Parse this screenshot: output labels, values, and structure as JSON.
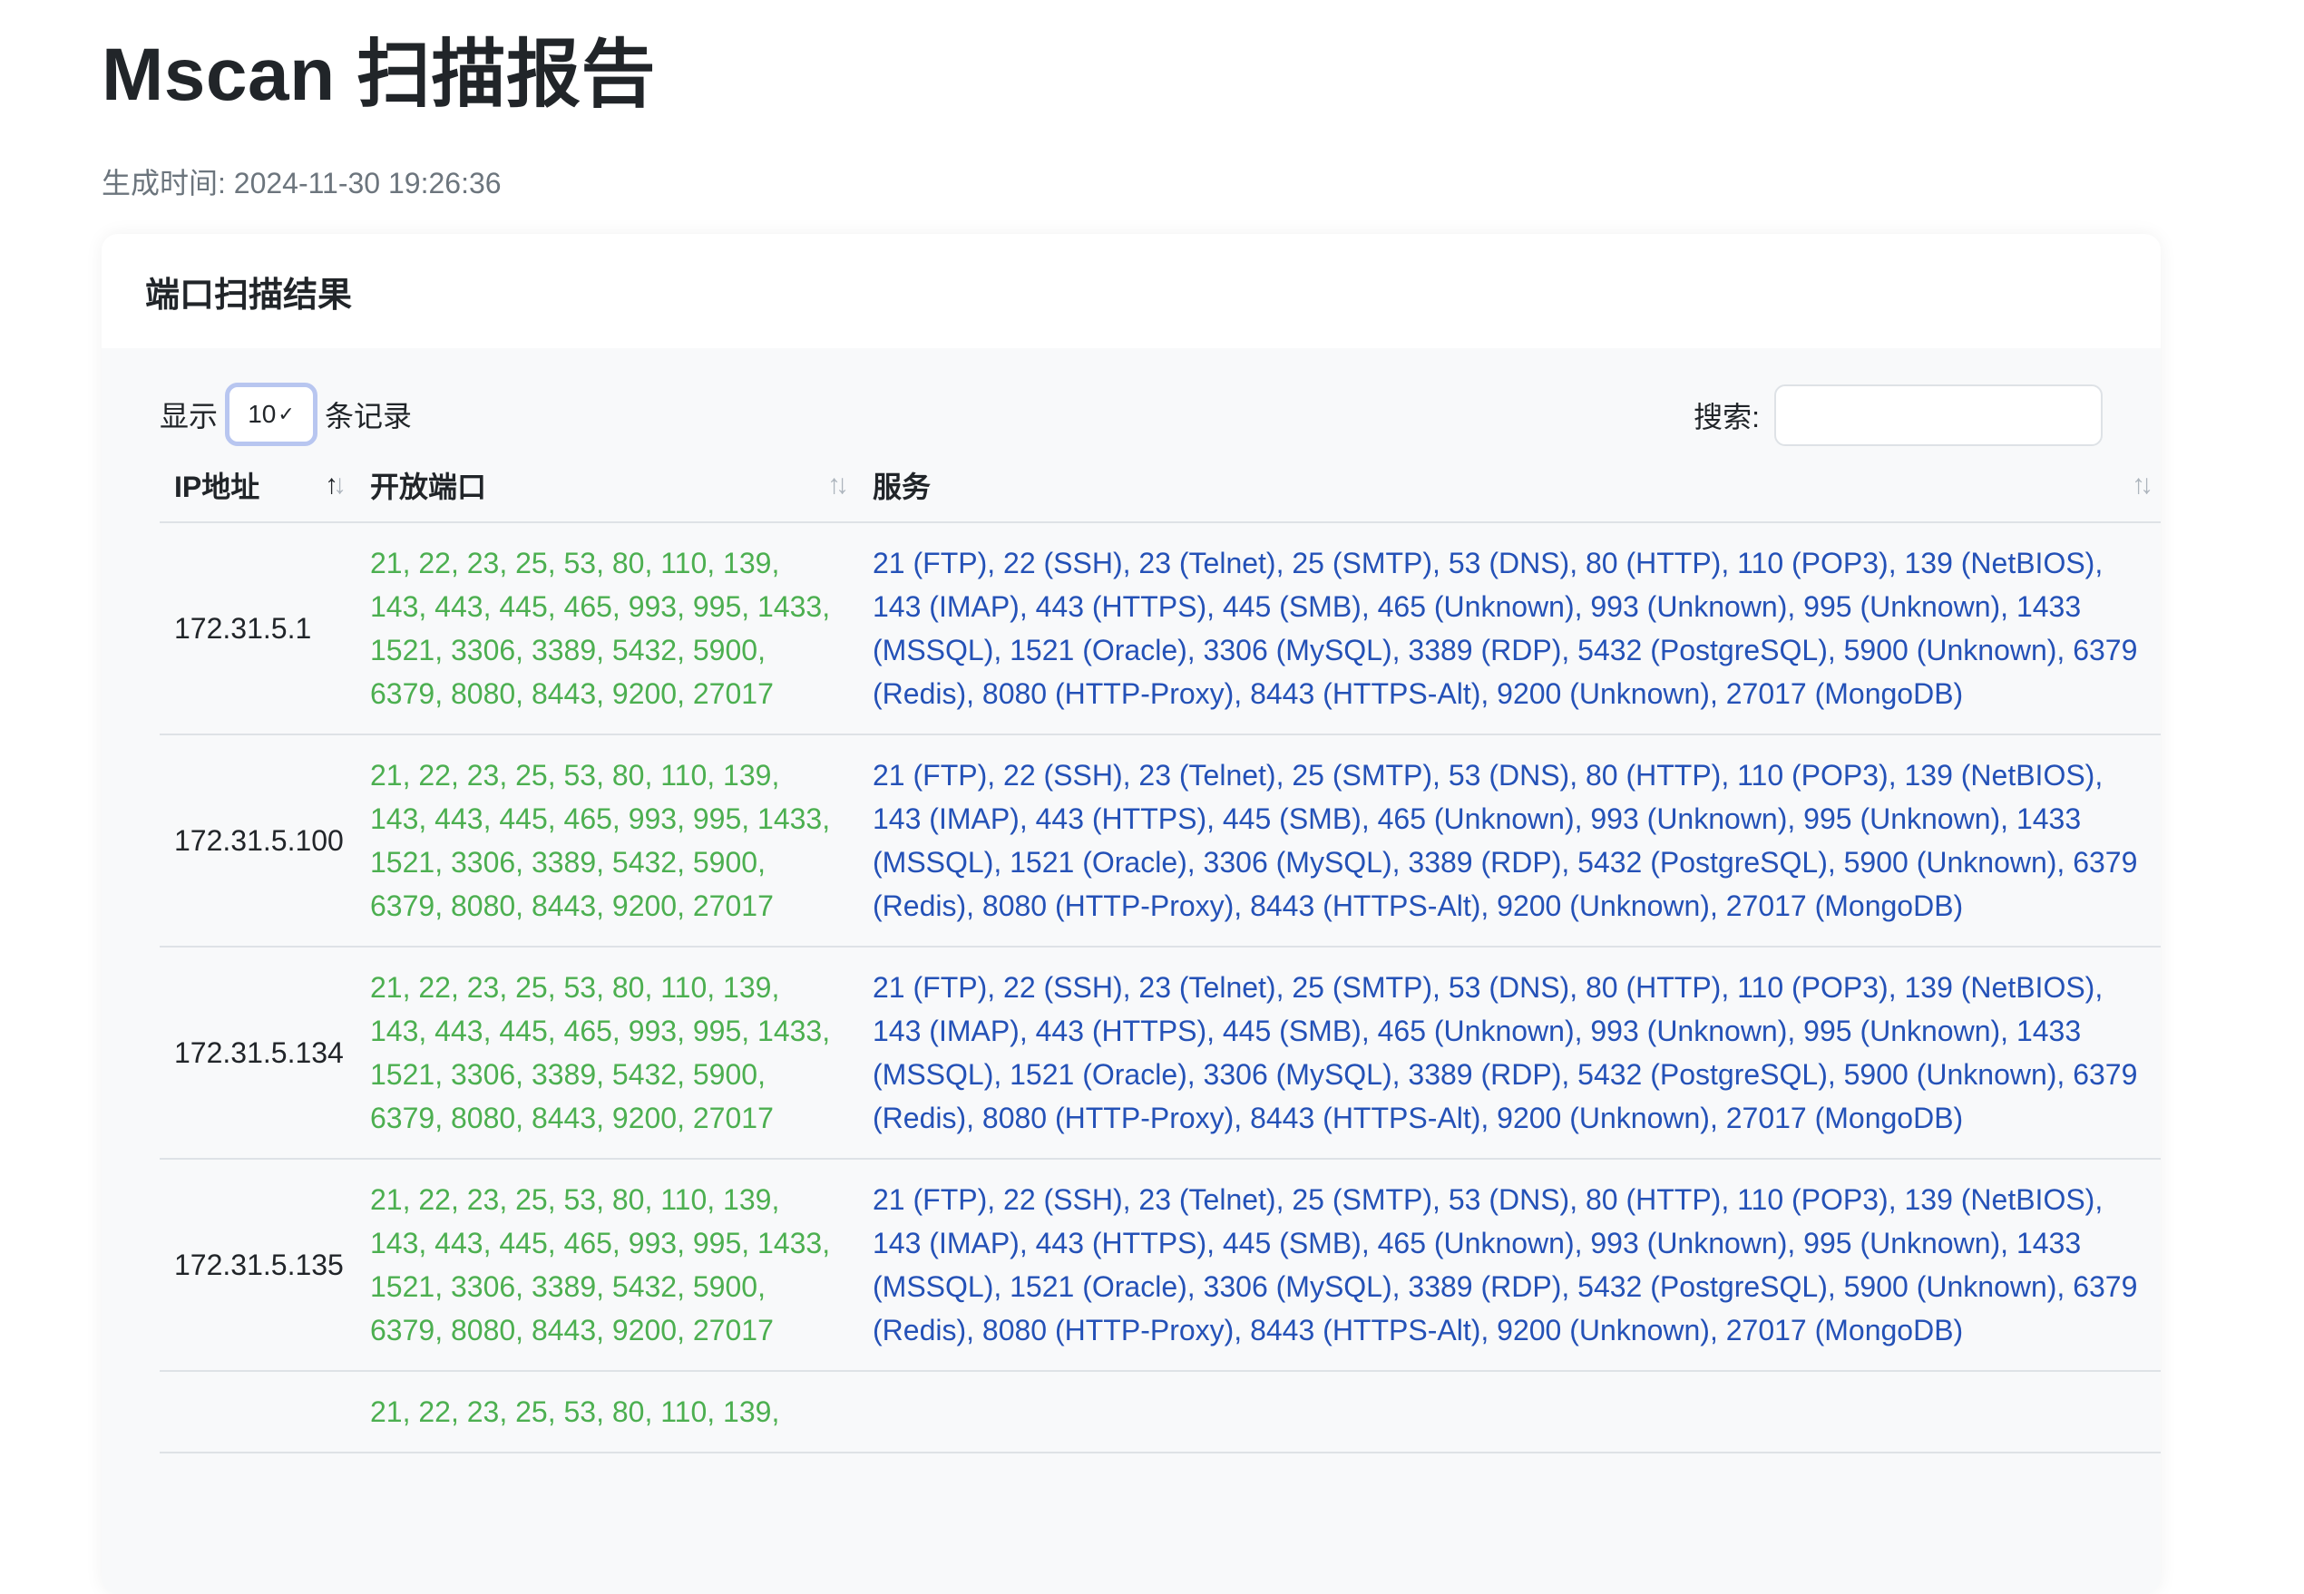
{
  "page": {
    "title": "Mscan 扫描报告",
    "generated": "生成时间: 2024-11-30 19:26:36"
  },
  "card": {
    "title": "端口扫描结果"
  },
  "controls": {
    "length_prefix": "显示",
    "length_value": "10",
    "length_suffix": "条记录",
    "search_label": "搜索:",
    "search_value": ""
  },
  "table": {
    "headers": [
      "IP地址",
      "开放端口",
      "服务"
    ],
    "rows": [
      {
        "ip": "172.31.5.1",
        "ports": "21, 22, 23, 25, 53, 80, 110, 139, 143, 443, 445, 465, 993, 995, 1433, 1521, 3306, 3389, 5432, 5900, 6379, 8080, 8443, 9200, 27017",
        "services": "21 (FTP), 22 (SSH), 23 (Telnet), 25 (SMTP), 53 (DNS), 80 (HTTP), 110 (POP3), 139 (NetBIOS), 143 (IMAP), 443 (HTTPS), 445 (SMB), 465 (Unknown), 993 (Unknown), 995 (Unknown), 1433 (MSSQL), 1521 (Oracle), 3306 (MySQL), 3389 (RDP), 5432 (PostgreSQL), 5900 (Unknown), 6379 (Redis), 8080 (HTTP-Proxy), 8443 (HTTPS-Alt), 9200 (Unknown), 27017 (MongoDB)"
      },
      {
        "ip": "172.31.5.100",
        "ports": "21, 22, 23, 25, 53, 80, 110, 139, 143, 443, 445, 465, 993, 995, 1433, 1521, 3306, 3389, 5432, 5900, 6379, 8080, 8443, 9200, 27017",
        "services": "21 (FTP), 22 (SSH), 23 (Telnet), 25 (SMTP), 53 (DNS), 80 (HTTP), 110 (POP3), 139 (NetBIOS), 143 (IMAP), 443 (HTTPS), 445 (SMB), 465 (Unknown), 993 (Unknown), 995 (Unknown), 1433 (MSSQL), 1521 (Oracle), 3306 (MySQL), 3389 (RDP), 5432 (PostgreSQL), 5900 (Unknown), 6379 (Redis), 8080 (HTTP-Proxy), 8443 (HTTPS-Alt), 9200 (Unknown), 27017 (MongoDB)"
      },
      {
        "ip": "172.31.5.134",
        "ports": "21, 22, 23, 25, 53, 80, 110, 139, 143, 443, 445, 465, 993, 995, 1433, 1521, 3306, 3389, 5432, 5900, 6379, 8080, 8443, 9200, 27017",
        "services": "21 (FTP), 22 (SSH), 23 (Telnet), 25 (SMTP), 53 (DNS), 80 (HTTP), 110 (POP3), 139 (NetBIOS), 143 (IMAP), 443 (HTTPS), 445 (SMB), 465 (Unknown), 993 (Unknown), 995 (Unknown), 1433 (MSSQL), 1521 (Oracle), 3306 (MySQL), 3389 (RDP), 5432 (PostgreSQL), 5900 (Unknown), 6379 (Redis), 8080 (HTTP-Proxy), 8443 (HTTPS-Alt), 9200 (Unknown), 27017 (MongoDB)"
      },
      {
        "ip": "172.31.5.135",
        "ports": "21, 22, 23, 25, 53, 80, 110, 139, 143, 443, 445, 465, 993, 995, 1433, 1521, 3306, 3389, 5432, 5900, 6379, 8080, 8443, 9200, 27017",
        "services": "21 (FTP), 22 (SSH), 23 (Telnet), 25 (SMTP), 53 (DNS), 80 (HTTP), 110 (POP3), 139 (NetBIOS), 143 (IMAP), 443 (HTTPS), 445 (SMB), 465 (Unknown), 993 (Unknown), 995 (Unknown), 1433 (MSSQL), 1521 (Oracle), 3306 (MySQL), 3389 (RDP), 5432 (PostgreSQL), 5900 (Unknown), 6379 (Redis), 8080 (HTTP-Proxy), 8443 (HTTPS-Alt), 9200 (Unknown), 27017 (MongoDB)"
      },
      {
        "ip": "",
        "ports": "21, 22, 23, 25, 53, 80, 110, 139,",
        "services": ""
      }
    ]
  },
  "colors": {
    "ports": "#4caf50",
    "services": "#2451b7",
    "muted": "#6c757d"
  }
}
